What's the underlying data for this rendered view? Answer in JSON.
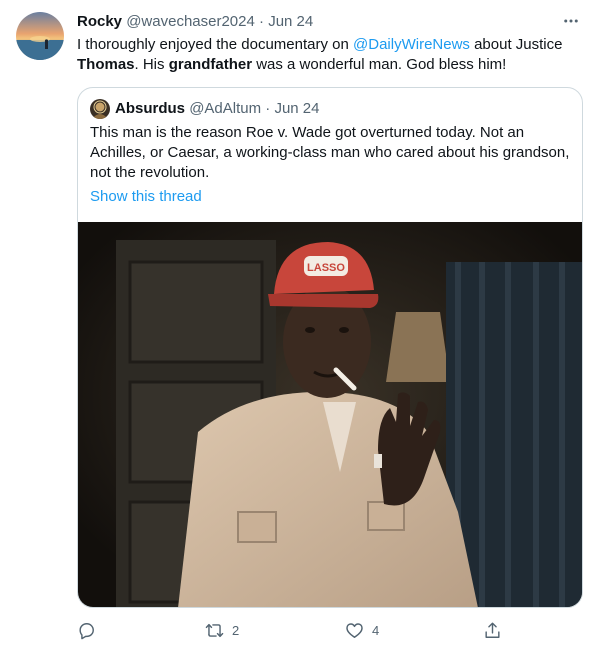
{
  "tweet": {
    "author_name": "Rocky",
    "author_handle": "@wavechaser2024",
    "separator": "·",
    "time": "Jun 24",
    "text_before_mention": "I thoroughly enjoyed the documentary on ",
    "mention": "@DailyWireNews",
    "text_after_mention": " about Justice",
    "text_bold_1": "Thomas",
    "text_mid": ". His ",
    "text_bold_2": "grandfather",
    "text_end": " was a wonderful man. God bless him!"
  },
  "quoted": {
    "author_name": "Absurdus",
    "author_handle": "@AdAltum",
    "separator": "·",
    "time": "Jun 24",
    "text": "This man is the reason Roe v. Wade got overturned today. Not an Achilles, or Caesar, a working-class man who cared about his grandson, not the revolution.",
    "show_thread_label": "Show this thread",
    "photo_cap_text": "LASSO"
  },
  "actions": {
    "reply_count": "",
    "retweet_count": "2",
    "like_count": "4"
  },
  "icons": {
    "more": "more-dots-icon",
    "reply": "reply-icon",
    "retweet": "retweet-icon",
    "like": "heart-icon",
    "share": "share-icon"
  },
  "colors": {
    "accent": "#1d9bf0",
    "secondary_text": "#536471",
    "border": "#cfd9de"
  }
}
